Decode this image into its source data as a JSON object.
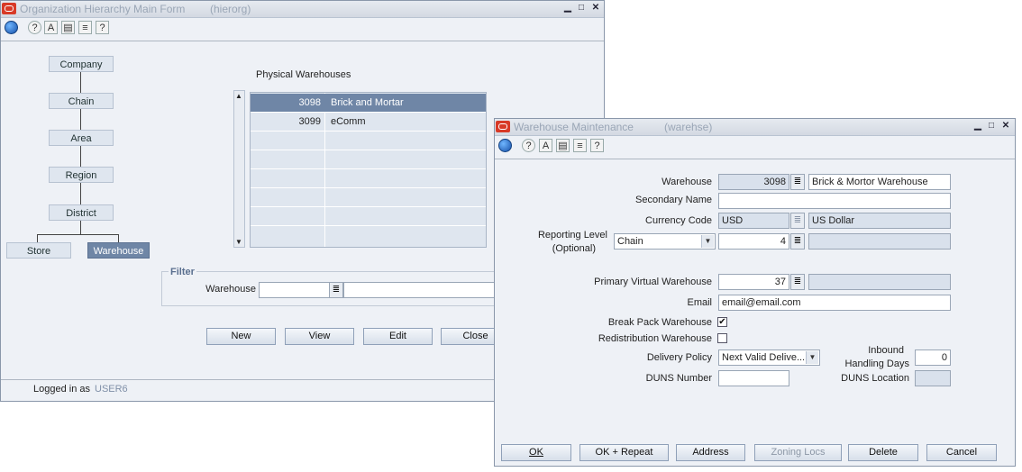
{
  "main_window": {
    "title": "Organization Hierarchy Main Form",
    "form_id": "(hierorg)",
    "hierarchy": [
      "Company",
      "Chain",
      "Area",
      "Region",
      "District",
      "Store",
      "Warehouse"
    ],
    "grid_title": "Physical Warehouses",
    "rows": [
      {
        "id": "3098",
        "name": "Brick and Mortar"
      },
      {
        "id": "3099",
        "name": "eComm"
      }
    ],
    "filter": {
      "title": "Filter",
      "warehouse_label": "Warehouse",
      "warehouse_value": "",
      "warehouse_desc": ""
    },
    "buttons": {
      "new": "New",
      "view": "View",
      "edit": "Edit",
      "close": "Close"
    },
    "status": {
      "logged_in_label": "Logged in as",
      "user": "USER6"
    }
  },
  "detail_window": {
    "title": "Warehouse Maintenance",
    "form_id": "(warehse)",
    "fields": {
      "warehouse_label": "Warehouse",
      "warehouse_id": "3098",
      "warehouse_name": "Brick & Mortor Warehouse",
      "secondary_name_label": "Secondary Name",
      "secondary_name": "",
      "currency_label": "Currency Code",
      "currency_code": "USD",
      "currency_desc": "US Dollar",
      "reporting_level_label": "Reporting Level",
      "reporting_level_optional": "(Optional)",
      "reporting_level": "Chain",
      "reporting_level_id": "4",
      "reporting_level_desc": "",
      "primary_vwh_label": "Primary Virtual Warehouse",
      "primary_vwh": "37",
      "primary_vwh_desc": "",
      "email_label": "Email",
      "email": "email@email.com",
      "break_pack_label": "Break Pack Warehouse",
      "break_pack_checked": true,
      "redistribution_label": "Redistribution Warehouse",
      "redistribution_checked": false,
      "delivery_policy_label": "Delivery Policy",
      "delivery_policy": "Next Valid Delive...",
      "inbound_label_1": "Inbound",
      "inbound_label_2": "Handling Days",
      "inbound_days": "0",
      "duns_number_label": "DUNS Number",
      "duns_number": "",
      "duns_location_label": "DUNS Location",
      "duns_location": ""
    },
    "buttons": {
      "ok": "OK",
      "ok_repeat": "OK + Repeat",
      "address": "Address",
      "zoning_locs": "Zoning Locs",
      "delete": "Delete",
      "cancel": "Cancel"
    }
  }
}
